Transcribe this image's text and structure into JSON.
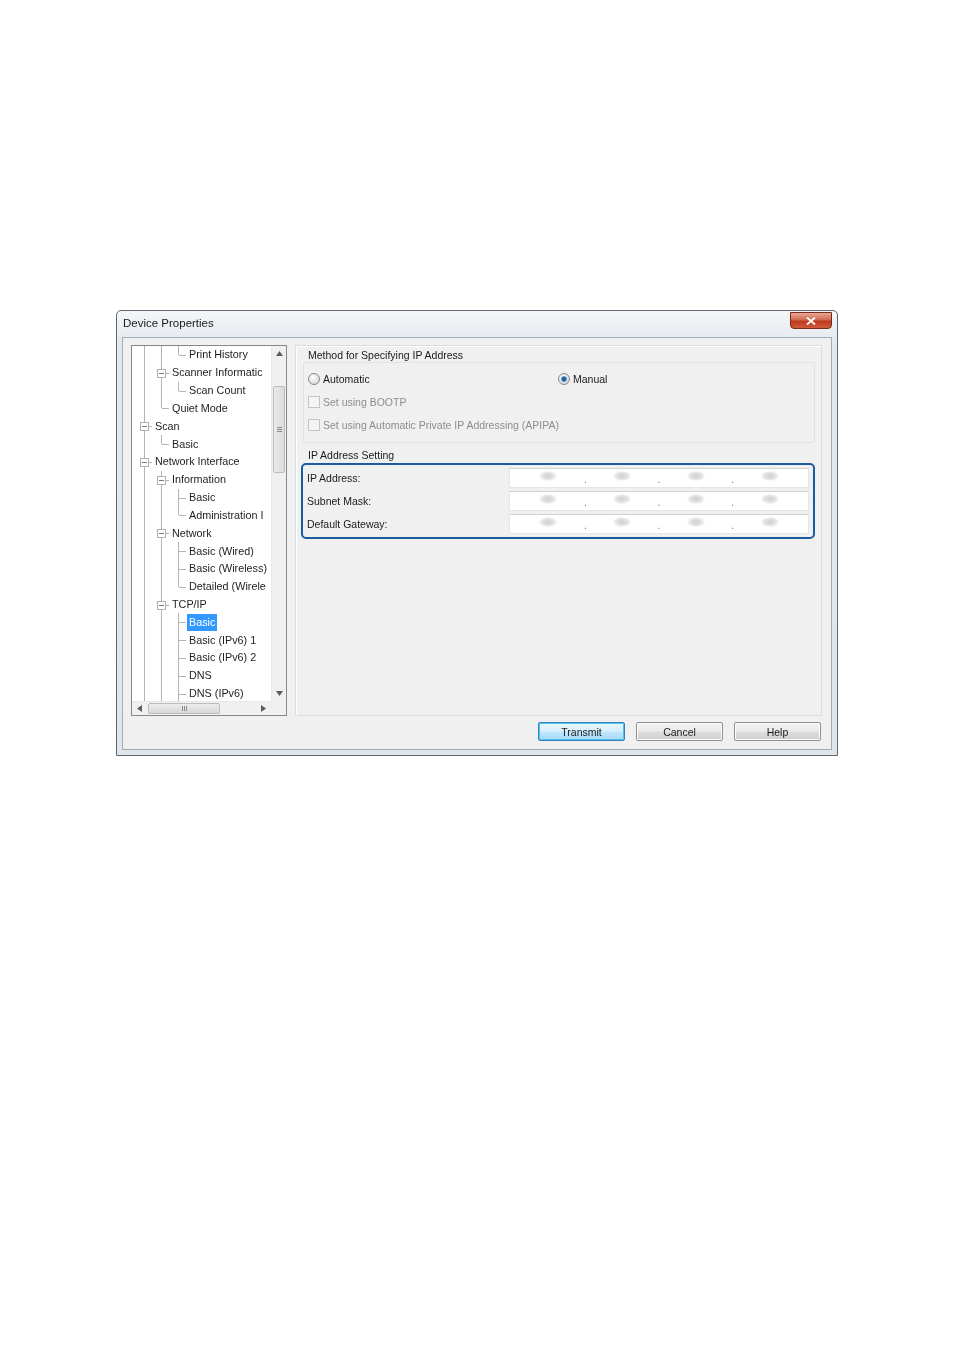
{
  "window": {
    "title": "Device Properties"
  },
  "tree": {
    "items": [
      {
        "children": [
          {
            "children": [
              {
                "label": "Print History",
                "selected": false
              }
            ]
          },
          {
            "label": "Scanner Informatic",
            "expanded": true,
            "selected": false,
            "children": [
              {
                "label": "Scan Count",
                "selected": false
              }
            ]
          },
          {
            "label": "Quiet Mode",
            "selected": false
          }
        ]
      },
      {
        "label": "Scan",
        "expanded": true,
        "selected": false,
        "children": [
          {
            "label": "Basic",
            "selected": false
          }
        ]
      },
      {
        "label": "Network Interface",
        "expanded": true,
        "selected": false,
        "children": [
          {
            "label": "Information",
            "expanded": true,
            "selected": false,
            "children": [
              {
                "label": "Basic",
                "selected": false
              },
              {
                "label": "Administration I",
                "selected": false
              }
            ]
          },
          {
            "label": "Network",
            "expanded": true,
            "selected": false,
            "children": [
              {
                "label": "Basic (Wired)",
                "selected": false
              },
              {
                "label": "Basic (Wireless)",
                "selected": false
              },
              {
                "label": "Detailed (Wirele",
                "selected": false
              }
            ]
          },
          {
            "label": "TCP/IP",
            "expanded": true,
            "selected": false,
            "children": [
              {
                "label": "Basic",
                "selected": true
              },
              {
                "label": "Basic (IPv6) 1",
                "selected": false
              },
              {
                "label": "Basic (IPv6) 2",
                "selected": false
              },
              {
                "label": "DNS",
                "selected": false
              },
              {
                "label": "DNS (IPv6)",
                "selected": false
              }
            ]
          }
        ]
      }
    ]
  },
  "method_group": {
    "title": "Method for Specifying IP Address",
    "options": [
      {
        "label": "Automatic",
        "selected": false
      },
      {
        "label": "Manual",
        "selected": true
      }
    ],
    "checkboxes": [
      {
        "label": "Set using BOOTP",
        "checked": false,
        "disabled": true
      },
      {
        "label": "Set using Automatic Private IP Addressing (APIPA)",
        "checked": false,
        "disabled": true
      }
    ]
  },
  "ip_group": {
    "title": "IP Address Setting",
    "highlighted": true,
    "fields": [
      {
        "label": "IP Address:",
        "separators": [
          ".",
          ".",
          "."
        ]
      },
      {
        "label": "Subnet Mask:",
        "separators": [
          ".",
          ".",
          "."
        ]
      },
      {
        "label": "Default Gateway:",
        "separators": [
          ".",
          ".",
          "."
        ]
      }
    ]
  },
  "buttons": [
    {
      "label": "Transmit",
      "default": true
    },
    {
      "label": "Cancel",
      "default": false
    },
    {
      "label": "Help",
      "default": false
    }
  ]
}
